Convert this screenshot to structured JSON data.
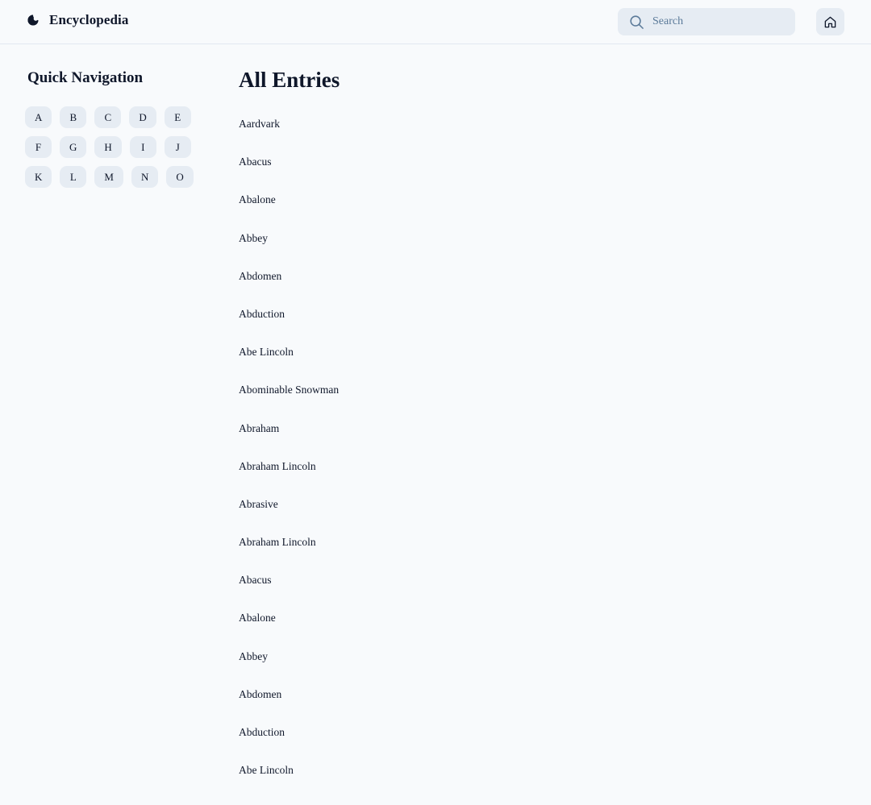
{
  "header": {
    "brand_title": "Encyclopedia",
    "brand_logo_icon": "crescent-logo-icon",
    "search": {
      "placeholder": "Search",
      "value": "",
      "icon": "search-icon"
    },
    "home_icon": "home-icon"
  },
  "sidebar": {
    "title": "Quick Navigation",
    "letter_rows": [
      [
        "A",
        "B",
        "C",
        "D",
        "E"
      ],
      [
        "F",
        "G",
        "H",
        "I",
        "J"
      ],
      [
        "K",
        "L",
        "M",
        "N",
        "O"
      ]
    ]
  },
  "main": {
    "title": "All Entries",
    "entries": [
      "Aardvark",
      "Abacus",
      "Abalone",
      "Abbey",
      "Abdomen",
      "Abduction",
      "Abe Lincoln",
      "Abominable Snowman",
      "Abraham",
      "Abraham Lincoln",
      "Abrasive",
      "Abraham Lincoln",
      "Abacus",
      "Abalone",
      "Abbey",
      "Abdomen",
      "Abduction",
      "Abe Lincoln"
    ]
  },
  "colors": {
    "page_background": "#f8fafc",
    "surface": "#e6ecf3",
    "text": "#0f172a",
    "muted_text": "#5b7a99",
    "divider": "#e2e8f0"
  }
}
